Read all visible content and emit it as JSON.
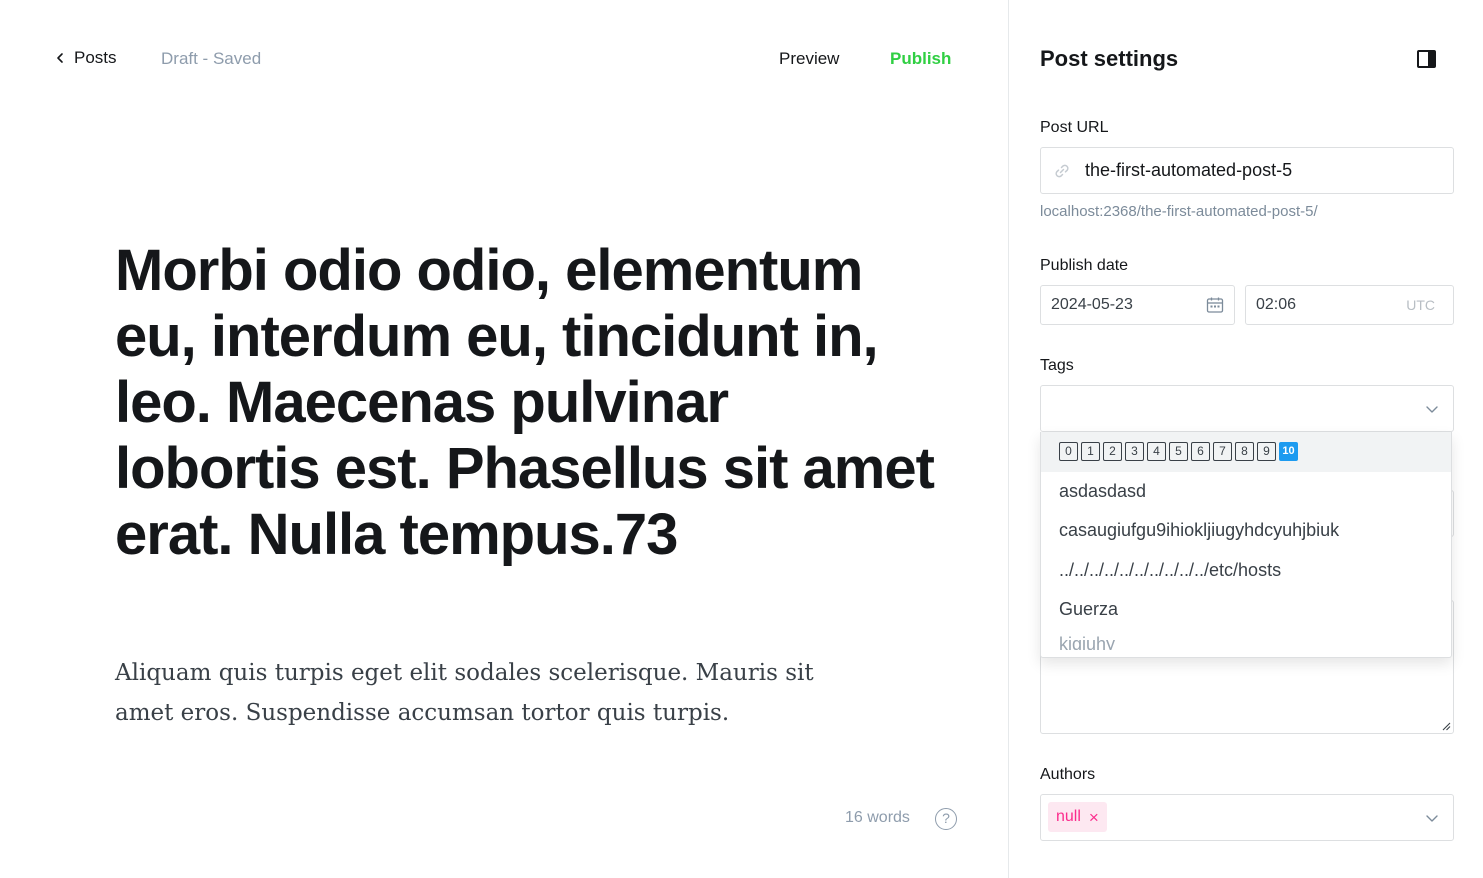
{
  "topbar": {
    "back_label": "Posts",
    "status": "Draft - Saved",
    "preview_label": "Preview",
    "publish_label": "Publish"
  },
  "post": {
    "title": "Morbi odio odio, elementum eu, interdum eu, tincidunt in, leo. Maecenas pulvinar lobortis est. Phasellus sit amet erat. Nulla tempus.73",
    "excerpt": "Aliquam quis turpis eget elit sodales scelerisque. Mauris sit amet eros. Suspendisse accumsan tortor quis turpis."
  },
  "footer": {
    "word_count": "16 words",
    "help_icon": "question-circle-icon"
  },
  "settings": {
    "title": "Post settings",
    "toggle_icon": "sidebar-toggle-icon",
    "post_url": {
      "label": "Post URL",
      "value": "the-first-automated-post-5",
      "hint": "localhost:2368/the-first-automated-post-5/",
      "icon": "link-icon"
    },
    "publish_date": {
      "label": "Publish date",
      "date": "2024-05-23",
      "time": "02:06",
      "timezone": "UTC",
      "icon": "calendar-icon"
    },
    "tags": {
      "label": "Tags",
      "value": "",
      "options": [
        {
          "keycaps": [
            "0",
            "1",
            "2",
            "3",
            "4",
            "5",
            "6",
            "7",
            "8",
            "9",
            "10"
          ]
        },
        {
          "label": "asdasdasd"
        },
        {
          "label": "casaugiufgu9ihiokljiugyhdcyuhjbiuk"
        },
        {
          "label": "../../../../../../../../../../etc/hosts"
        },
        {
          "label": "Guerza"
        },
        {
          "label": "kigiuhy"
        }
      ]
    },
    "authors": {
      "label": "Authors",
      "selected": [
        "null"
      ]
    }
  },
  "colors": {
    "publish": "#30cf43",
    "author_chip_bg": "#fde8f1",
    "author_chip_text": "#fb2d8d",
    "keycap_highlight": "#1d9bf0"
  }
}
